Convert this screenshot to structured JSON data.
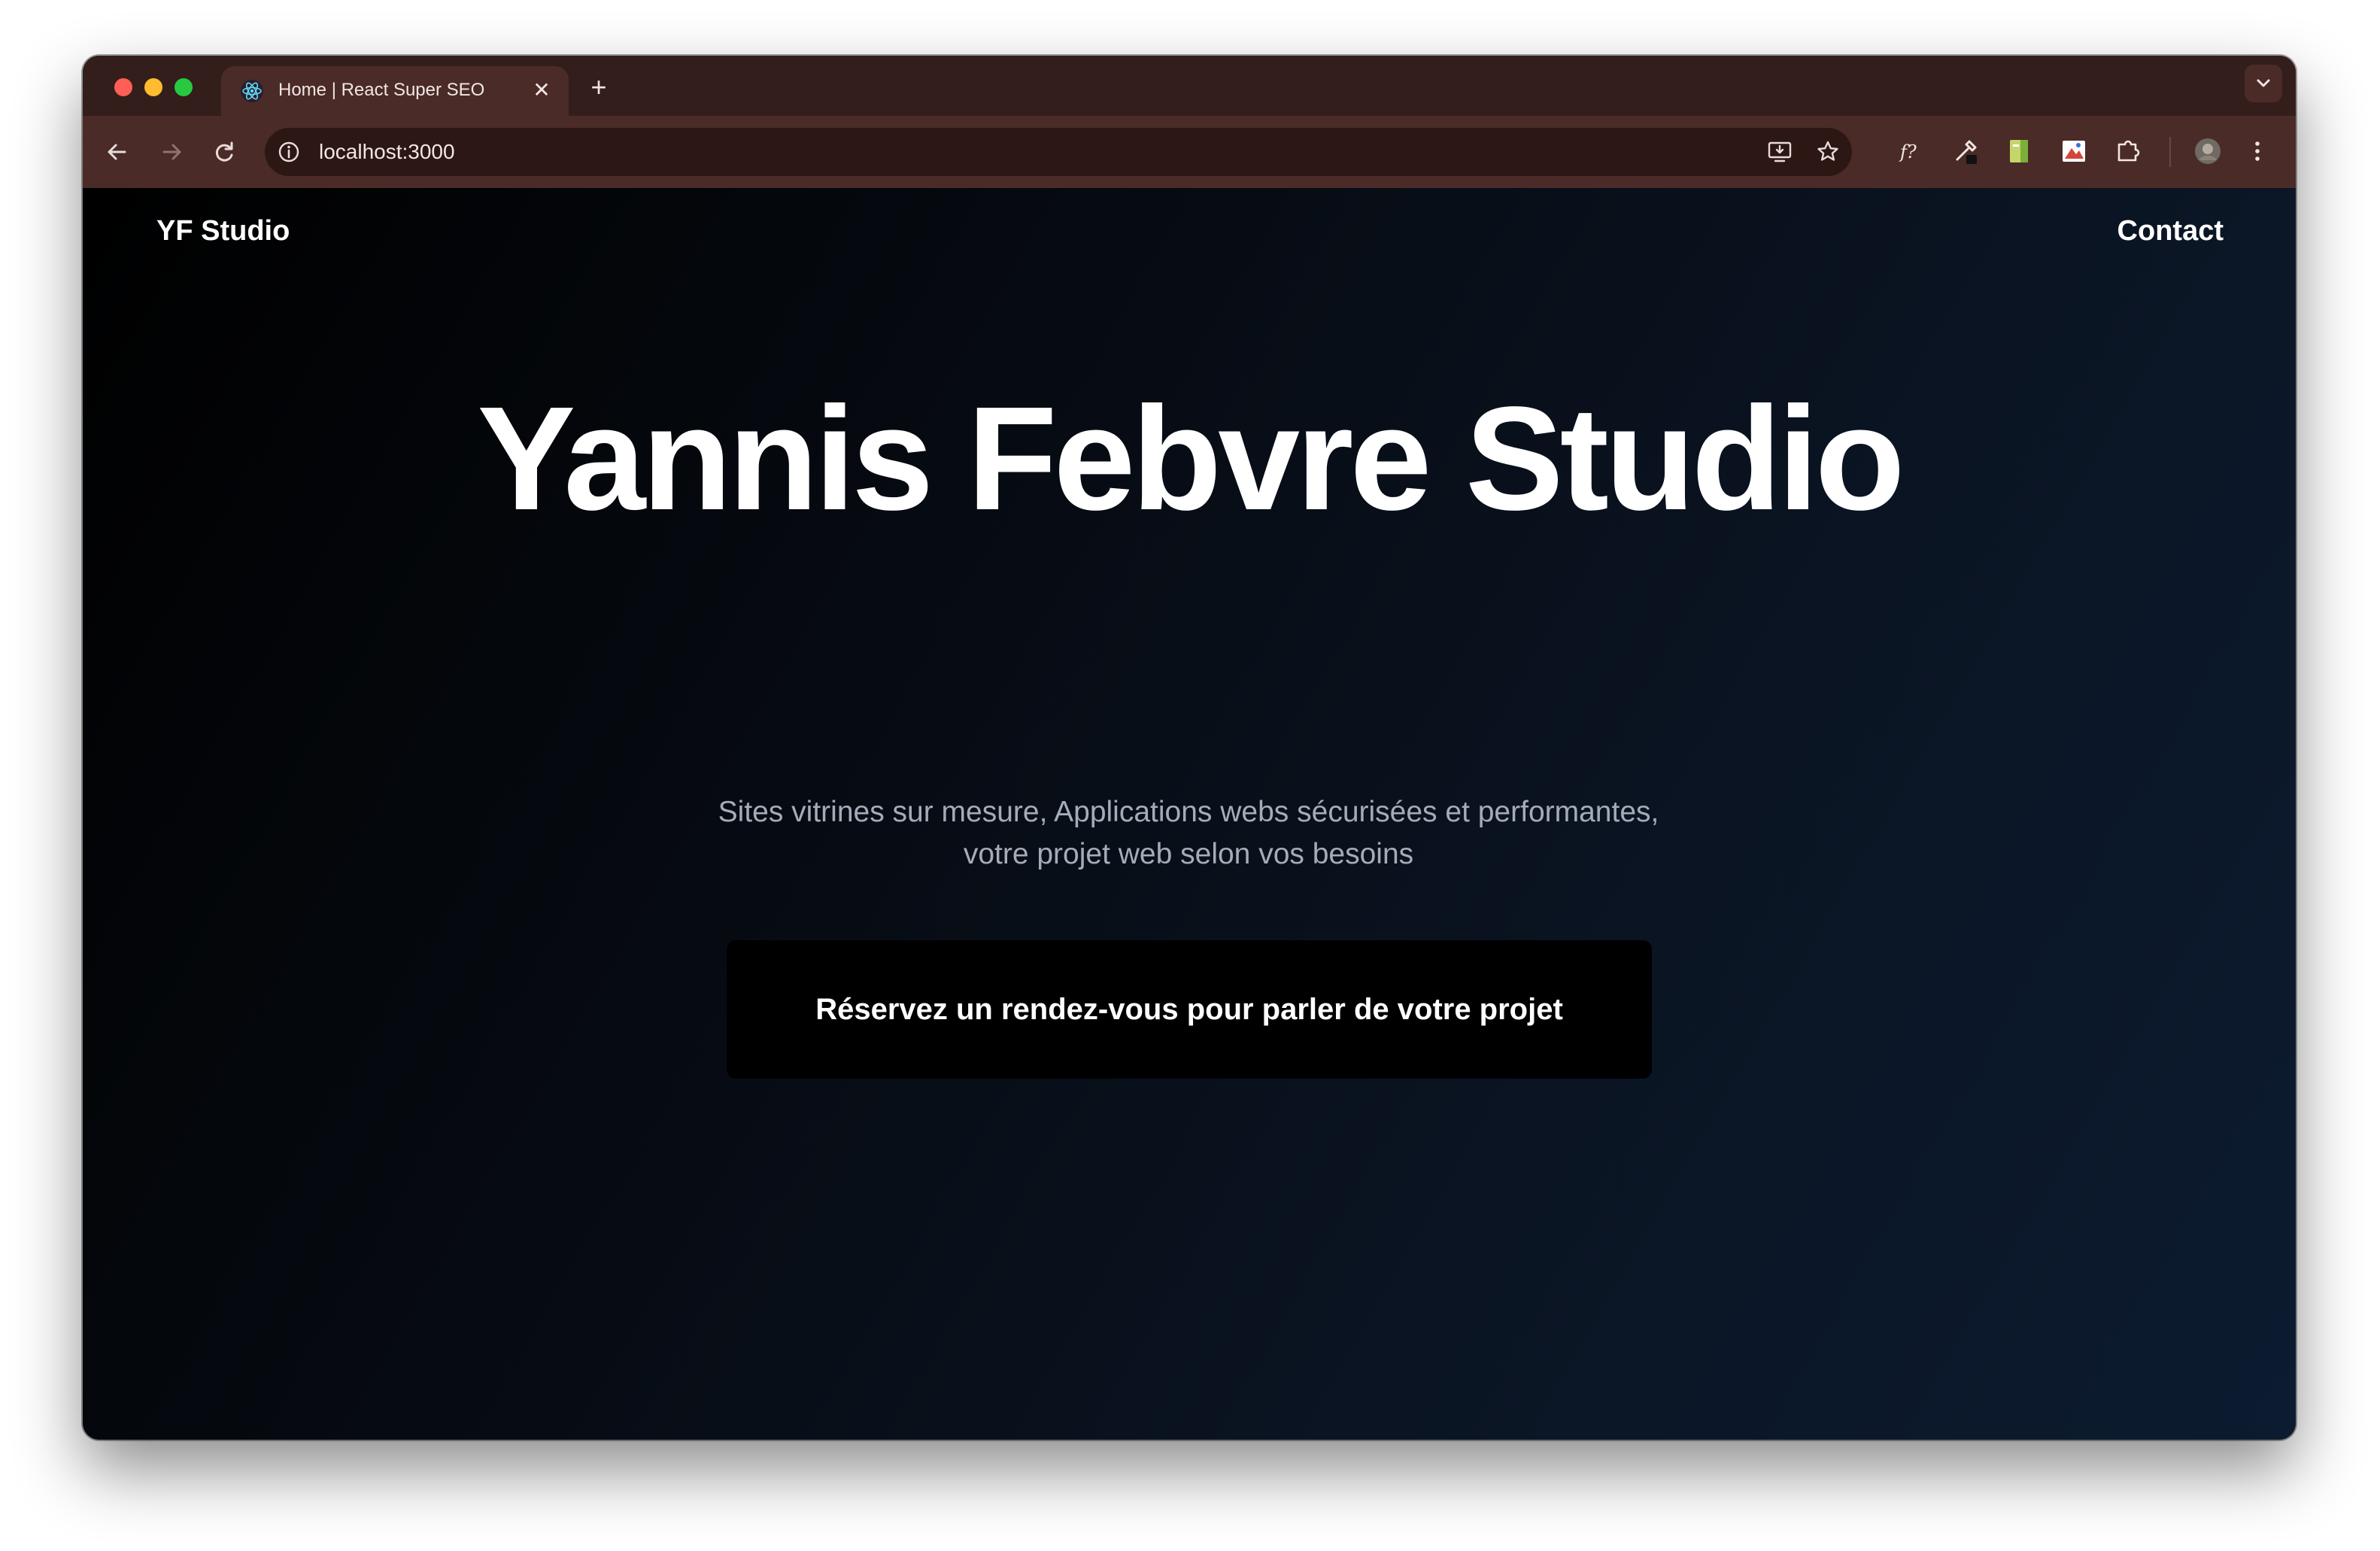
{
  "browser": {
    "tab_title": "Home | React Super SEO",
    "close_symbol": "✕",
    "new_tab_symbol": "+",
    "url": "localhost:3000",
    "toolbar_icons": [
      "back-icon",
      "forward-icon",
      "reload-icon",
      "site-info-icon",
      "install-app-icon",
      "bookmark-star-icon",
      "formula-extension-icon",
      "eyedropper-extension-icon",
      "notes-extension-icon",
      "image-extension-icon",
      "extensions-puzzle-icon",
      "profile-avatar",
      "more-menu-icon"
    ],
    "colors": {
      "tabstrip": "#331e1b",
      "toolbar": "#4a2b27",
      "omnibox": "#2c1714"
    }
  },
  "page": {
    "brand": "YF Studio",
    "nav_contact": "Contact",
    "hero_title": "Yannis Febvre Studio",
    "subtitle_line1": "Sites vitrines sur mesure, Applications webs sécurisées et performantes,",
    "subtitle_line2": "votre projet web selon vos besoins",
    "cta_label": "Réservez un rendez-vous pour parler de votre projet",
    "colors": {
      "background_start": "#000000",
      "background_end": "#0c1b30",
      "subtitle": "#a5acb8",
      "cta_bg": "#000000"
    }
  }
}
